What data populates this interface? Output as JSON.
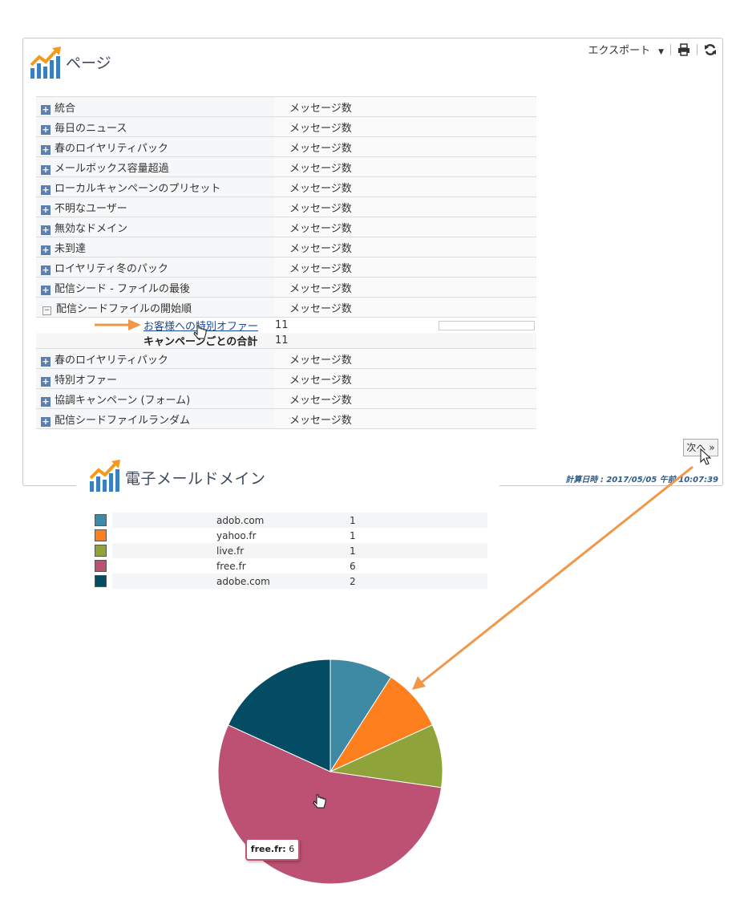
{
  "header": {
    "title": "ページ",
    "export_label": "エクスポート"
  },
  "report": {
    "rows": [
      {
        "label": "統合",
        "value": "メッセージ数"
      },
      {
        "label": "毎日のニュース",
        "value": "メッセージ数"
      },
      {
        "label": "春のロイヤリティパック",
        "value": "メッセージ数"
      },
      {
        "label": "メールボックス容量超過",
        "value": "メッセージ数"
      },
      {
        "label": "ローカルキャンペーンのプリセット",
        "value": "メッセージ数"
      },
      {
        "label": "不明なユーザー",
        "value": "メッセージ数"
      },
      {
        "label": "無効なドメイン",
        "value": "メッセージ数"
      },
      {
        "label": "未到達",
        "value": "メッセージ数"
      },
      {
        "label": "ロイヤリティ冬のパック",
        "value": "メッセージ数"
      },
      {
        "label": "配信シード - ファイルの最後",
        "value": "メッセージ数"
      },
      {
        "label": "配信シードファイルの開始順",
        "value": "メッセージ数"
      },
      {
        "label": "春のロイヤリティパック",
        "value": "メッセージ数"
      },
      {
        "label": "特別オファー",
        "value": "メッセージ数"
      },
      {
        "label": "協調キャンペーン (フォーム)",
        "value": "メッセージ数"
      },
      {
        "label": "配信シードファイルランダム",
        "value": "メッセージ数"
      }
    ],
    "expanded": {
      "link_label": "お客様への特別オファー",
      "link_value": "11",
      "total_label": "キャンペーンごとの合計",
      "total_value": "11"
    }
  },
  "pager": {
    "next_label": "次へ »"
  },
  "calc_time": "計算日時 : 2017/05/05 午前 10:07:39",
  "email_section": {
    "title": "電子メールドメイン",
    "domains": [
      {
        "name": "adob.com",
        "count": "1",
        "color": "#3e89a3"
      },
      {
        "name": "yahoo.fr",
        "count": "1",
        "color": "#fd7f1d"
      },
      {
        "name": "live.fr",
        "count": "1",
        "color": "#8ea43a"
      },
      {
        "name": "free.fr",
        "count": "6",
        "color": "#bc5174"
      },
      {
        "name": "adobe.com",
        "count": "2",
        "color": "#044c64"
      }
    ],
    "tooltip": {
      "name": "free.fr:",
      "value": "6"
    }
  },
  "chart_data": {
    "type": "pie",
    "categories": [
      "adob.com",
      "yahoo.fr",
      "live.fr",
      "free.fr",
      "adobe.com"
    ],
    "values": [
      1,
      1,
      1,
      6,
      2
    ],
    "colors": [
      "#3e89a3",
      "#fd7f1d",
      "#8ea43a",
      "#bc5174",
      "#044c64"
    ]
  },
  "colors": {
    "accent_arrow": "#f0974a",
    "link": "#1a4a9a",
    "title": "#3c4a5e"
  }
}
